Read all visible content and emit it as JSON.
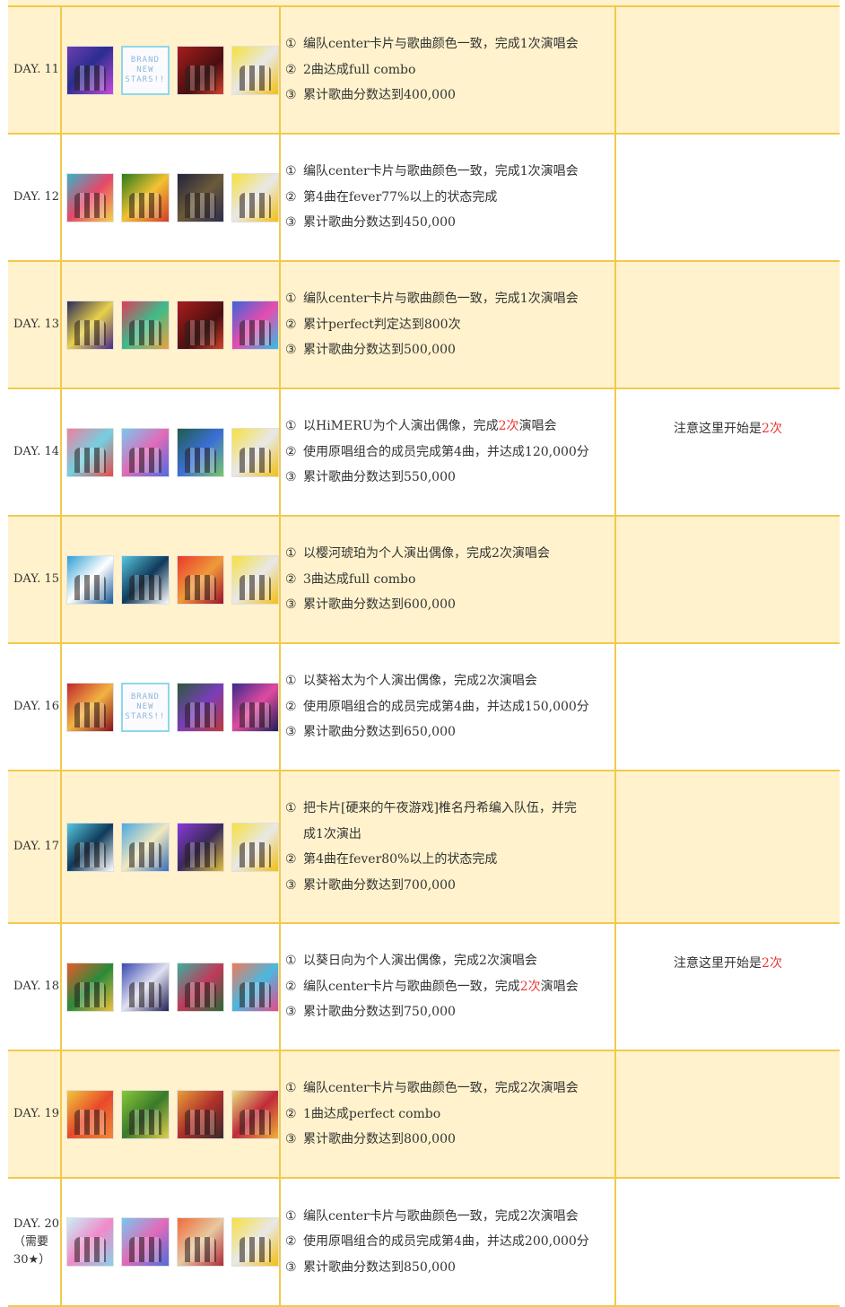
{
  "rows": [
    {
      "day": "DAY. 11",
      "day2": "",
      "day3": "",
      "bg": "yellow",
      "thumbs": [
        "tile1",
        "brand",
        "tile2",
        "tile3"
      ],
      "tasks": [
        {
          "n": "①",
          "a": "编队center卡片与歌曲颜色一致，完成1次演唱会",
          "r": "",
          "b": ""
        },
        {
          "n": "②",
          "a": "2曲达成full combo",
          "r": "",
          "b": ""
        },
        {
          "n": "③",
          "a": "累计歌曲分数达到400,000",
          "r": "",
          "b": ""
        }
      ],
      "note": {
        "a": "",
        "r": ""
      }
    },
    {
      "day": "DAY. 12",
      "day2": "",
      "day3": "",
      "bg": "white",
      "thumbs": [
        "tile4",
        "tile5",
        "tile6",
        "tile3"
      ],
      "tasks": [
        {
          "n": "①",
          "a": "编队center卡片与歌曲颜色一致，完成1次演唱会",
          "r": "",
          "b": ""
        },
        {
          "n": "②",
          "a": "第4曲在fever77%以上的状态完成",
          "r": "",
          "b": ""
        },
        {
          "n": "③",
          "a": "累计歌曲分数达到450,000",
          "r": "",
          "b": ""
        }
      ],
      "note": {
        "a": "",
        "r": ""
      }
    },
    {
      "day": "DAY. 13",
      "day2": "",
      "day3": "",
      "bg": "yellow",
      "thumbs": [
        "tile30",
        "tile7",
        "tile2",
        "tile8"
      ],
      "tasks": [
        {
          "n": "①",
          "a": "编队center卡片与歌曲颜色一致，完成1次演唱会",
          "r": "",
          "b": ""
        },
        {
          "n": "②",
          "a": "累计perfect判定达到800次",
          "r": "",
          "b": ""
        },
        {
          "n": "③",
          "a": "累计歌曲分数达到500,000",
          "r": "",
          "b": ""
        }
      ],
      "note": {
        "a": "",
        "r": ""
      }
    },
    {
      "day": "DAY. 14",
      "day2": "",
      "day3": "",
      "bg": "white",
      "thumbs": [
        "tile9",
        "tile10",
        "tile11",
        "tile3"
      ],
      "tasks": [
        {
          "n": "①",
          "a": "以HiMERU为个人演出偶像，完成",
          "r": "2次",
          "b": "演唱会"
        },
        {
          "n": "②",
          "a": "使用原唱组合的成员完成第4曲，并达成120,000分",
          "r": "",
          "b": ""
        },
        {
          "n": "③",
          "a": "累计歌曲分数达到550,000",
          "r": "",
          "b": ""
        }
      ],
      "note": {
        "a": "注意这里开始是",
        "r": "2次"
      }
    },
    {
      "day": "DAY. 15",
      "day2": "",
      "day3": "",
      "bg": "yellow",
      "thumbs": [
        "tile12",
        "tile13",
        "tile14",
        "tile3"
      ],
      "tasks": [
        {
          "n": "①",
          "a": "以樱河琥珀为个人演出偶像，完成2次演唱会",
          "r": "",
          "b": ""
        },
        {
          "n": "②",
          "a": "3曲达成full combo",
          "r": "",
          "b": ""
        },
        {
          "n": "③",
          "a": "累计歌曲分数达到600,000",
          "r": "",
          "b": ""
        }
      ],
      "note": {
        "a": "",
        "r": ""
      }
    },
    {
      "day": "DAY. 16",
      "day2": "",
      "day3": "",
      "bg": "white",
      "thumbs": [
        "tile15",
        "brand",
        "tile16",
        "tile17"
      ],
      "tasks": [
        {
          "n": "①",
          "a": "以葵裕太为个人演出偶像，完成2次演唱会",
          "r": "",
          "b": ""
        },
        {
          "n": "②",
          "a": "使用原唱组合的成员完成第4曲，并达成150,000分",
          "r": "",
          "b": ""
        },
        {
          "n": "③",
          "a": "累计歌曲分数达到650,000",
          "r": "",
          "b": ""
        }
      ],
      "note": {
        "a": "",
        "r": ""
      }
    },
    {
      "day": "DAY. 17",
      "day2": "",
      "day3": "",
      "bg": "yellow",
      "thumbs": [
        "tile13",
        "tile18",
        "tile19",
        "tile3"
      ],
      "tasks": [
        {
          "n": "①",
          "a": "把卡片[硬来的午夜游戏]椎名丹希编入队伍，并完",
          "r": "",
          "b": ""
        },
        {
          "n": "",
          "a": "成1次演出",
          "r": "",
          "b": ""
        },
        {
          "n": "②",
          "a": "第4曲在fever80%以上的状态完成",
          "r": "",
          "b": ""
        },
        {
          "n": "③",
          "a": "累计歌曲分数达到700,000",
          "r": "",
          "b": ""
        }
      ],
      "note": {
        "a": "",
        "r": ""
      }
    },
    {
      "day": "DAY. 18",
      "day2": "",
      "day3": "",
      "bg": "white",
      "thumbs": [
        "tile20",
        "tile21",
        "tile22",
        "tile23"
      ],
      "tasks": [
        {
          "n": "①",
          "a": "以葵日向为个人演出偶像，完成2次演唱会",
          "r": "",
          "b": ""
        },
        {
          "n": "②",
          "a": "编队center卡片与歌曲颜色一致，完成",
          "r": "2次",
          "b": "演唱会"
        },
        {
          "n": "③",
          "a": "累计歌曲分数达到750,000",
          "r": "",
          "b": ""
        }
      ],
      "note": {
        "a": "注意这里开始是",
        "r": "2次"
      }
    },
    {
      "day": "DAY. 19",
      "day2": "",
      "day3": "",
      "bg": "yellow",
      "thumbs": [
        "tile24",
        "tile25",
        "tile26",
        "tile27"
      ],
      "tasks": [
        {
          "n": "①",
          "a": "编队center卡片与歌曲颜色一致，完成2次演唱会",
          "r": "",
          "b": ""
        },
        {
          "n": "②",
          "a": "1曲达成perfect combo",
          "r": "",
          "b": ""
        },
        {
          "n": "③",
          "a": "累计歌曲分数达到800,000",
          "r": "",
          "b": ""
        }
      ],
      "note": {
        "a": "",
        "r": ""
      }
    },
    {
      "day": "DAY. 20",
      "day2": "（需要",
      "day3": "30★）",
      "bg": "white",
      "thumbs": [
        "tile28",
        "tile10",
        "tile29",
        "tile3"
      ],
      "tasks": [
        {
          "n": "①",
          "a": "编队center卡片与歌曲颜色一致，完成2次演唱会",
          "r": "",
          "b": ""
        },
        {
          "n": "②",
          "a": "使用原唱组合的成员完成第4曲，并达成200,000分",
          "r": "",
          "b": ""
        },
        {
          "n": "③",
          "a": "累计歌曲分数达到850,000",
          "r": "",
          "b": ""
        }
      ],
      "note": {
        "a": "",
        "r": ""
      }
    }
  ],
  "brand_lines": [
    "BRAND",
    "NEW",
    "STARS!!"
  ]
}
